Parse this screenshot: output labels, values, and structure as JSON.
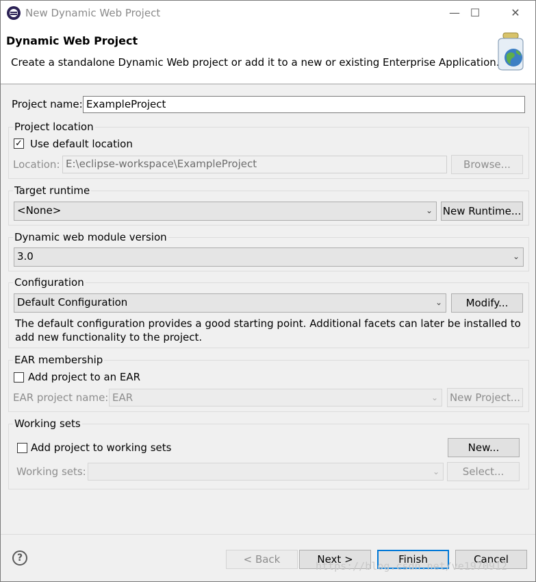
{
  "window": {
    "title": "New Dynamic Web Project",
    "minimize_icon": "—",
    "maximize_icon": "☐",
    "close_icon": "✕"
  },
  "banner": {
    "title": "Dynamic Web Project",
    "description": "Create a standalone Dynamic Web project or add it to a new or existing Enterprise Application."
  },
  "project_name": {
    "label": "Project name:",
    "value": "ExampleProject"
  },
  "project_location": {
    "title": "Project location",
    "use_default_label": "Use default location",
    "use_default_checked": true,
    "location_label": "Location:",
    "location_value": "E:\\eclipse-workspace\\ExampleProject",
    "browse_label": "Browse..."
  },
  "target_runtime": {
    "title": "Target runtime",
    "selected": "<None>",
    "new_runtime_label": "New Runtime..."
  },
  "module_version": {
    "title": "Dynamic web module version",
    "selected": "3.0"
  },
  "configuration": {
    "title": "Configuration",
    "selected": "Default Configuration",
    "modify_label": "Modify...",
    "description_line1": "The default configuration provides a good starting point. Additional facets can later be installed to",
    "description_line2": "add new functionality to the project."
  },
  "ear": {
    "title": "EAR membership",
    "add_label": "Add project to an EAR",
    "add_checked": false,
    "name_label": "EAR project name:",
    "name_value": "EAR",
    "new_project_label": "New Project..."
  },
  "working_sets": {
    "title": "Working sets",
    "add_label": "Add project to working sets",
    "add_checked": false,
    "new_label": "New...",
    "sets_label": "Working sets:",
    "sets_value": "",
    "select_label": "Select..."
  },
  "footer": {
    "help_icon": "?",
    "back_label": "< Back",
    "next_label": "Next >",
    "finish_label": "Finish",
    "cancel_label": "Cancel",
    "watermark": "https://blog.csdn.net/ve1970912"
  },
  "colors": {
    "accent": "#0078d7",
    "background": "#f0f0f0"
  }
}
